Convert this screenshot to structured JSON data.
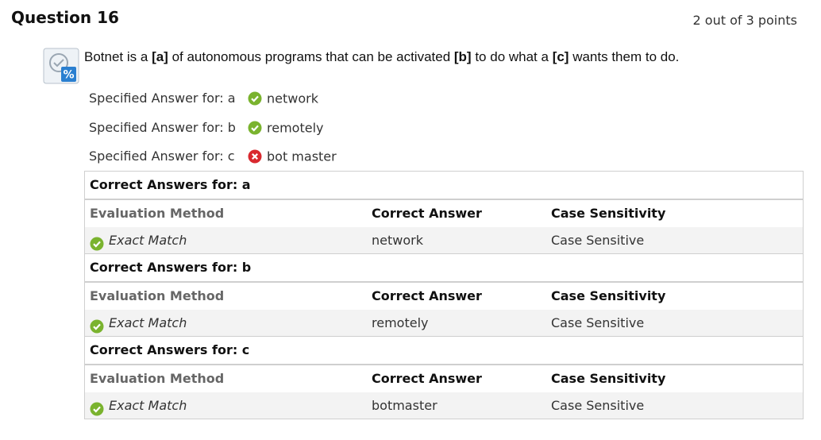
{
  "question": {
    "title": "Question 16",
    "points": "2 out of 3 points",
    "prompt_parts": [
      "Botnet is a ",
      "[a]",
      " of autonomous programs that can be activated ",
      "[b]",
      " to do what a ",
      "[c]",
      " wants them to do."
    ]
  },
  "specified": [
    {
      "label": "Specified Answer for: a",
      "value": "network",
      "status": "correct"
    },
    {
      "label": "Specified Answer for: b",
      "value": "remotely",
      "status": "correct"
    },
    {
      "label": "Specified Answer for: c",
      "value": "bot master",
      "status": "incorrect"
    }
  ],
  "columns": {
    "method": "Evaluation Method",
    "answer": "Correct Answer",
    "case": "Case Sensitivity"
  },
  "correct_answers": [
    {
      "heading": "Correct Answers for: a",
      "method": "Exact Match",
      "answer": "network",
      "case": "Case Sensitive"
    },
    {
      "heading": "Correct Answers for: b",
      "method": "Exact Match",
      "answer": "remotely",
      "case": "Case Sensitive"
    },
    {
      "heading": "Correct Answers for: c",
      "method": "Exact Match",
      "answer": "botmaster",
      "case": "Case Sensitive"
    }
  ],
  "colors": {
    "correct": "#7ab32e",
    "incorrect": "#d9292f",
    "border": "#cfcfcf",
    "row_bg": "#f3f3f3"
  }
}
